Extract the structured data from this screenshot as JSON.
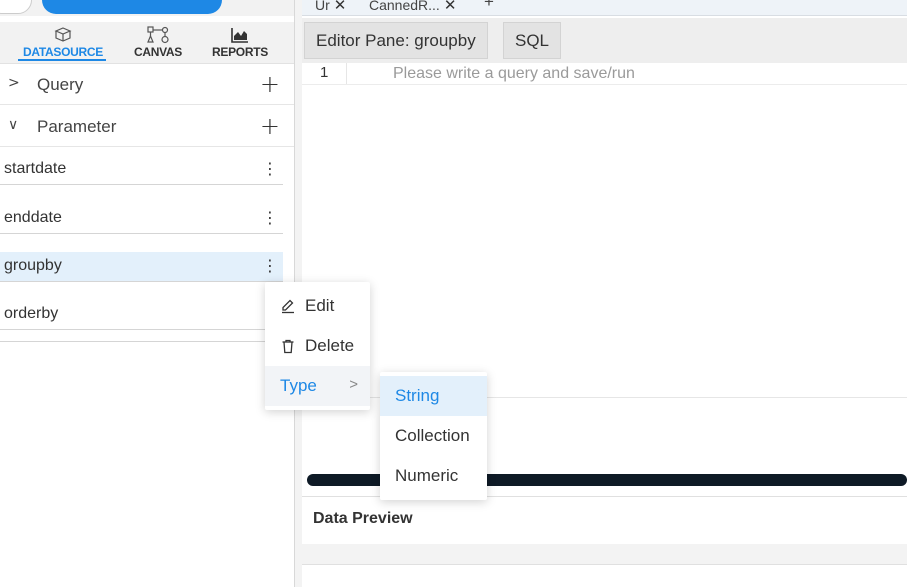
{
  "tabs": [
    {
      "label": "Ur"
    },
    {
      "label": "CannedR..."
    }
  ],
  "tab_add_label": "+",
  "nav": {
    "items": [
      {
        "label": "DATASOURCE",
        "icon": "database-icon"
      },
      {
        "label": "CANVAS",
        "icon": "canvas-icon"
      },
      {
        "label": "REPORTS",
        "icon": "reports-icon"
      }
    ],
    "active": "DATASOURCE"
  },
  "sections": {
    "query": {
      "title": "Query",
      "chevron": ">",
      "add": "+"
    },
    "parameter": {
      "title": "Parameter",
      "chevron": "∨",
      "add": "+"
    }
  },
  "parameters": [
    {
      "name": "startdate",
      "menu": "⋮"
    },
    {
      "name": "enddate",
      "menu": "⋮"
    },
    {
      "name": "groupby",
      "menu": "⋮"
    },
    {
      "name": "orderby",
      "menu": ""
    }
  ],
  "selected_parameter": "groupby",
  "toolbar": {
    "editor_pane_label": "Editor Pane: groupby",
    "sql_label": "SQL"
  },
  "editor": {
    "line_number": "1",
    "placeholder": "Please write a query and save/run"
  },
  "context_menu": {
    "items": [
      {
        "label": "Edit",
        "icon": "pencil-icon"
      },
      {
        "label": "Delete",
        "icon": "trash-icon"
      },
      {
        "label": "Type",
        "icon": "",
        "submenu_arrow": ">"
      }
    ]
  },
  "type_submenu": {
    "items": [
      {
        "label": "String",
        "selected": true
      },
      {
        "label": "Collection",
        "selected": false
      },
      {
        "label": "Numeric",
        "selected": false
      }
    ]
  },
  "data_preview": {
    "title": "Data Preview"
  },
  "colors": {
    "accent": "#1e88e5",
    "selected_row": "#e3f0fb",
    "scrollbar": "#0e1a26"
  }
}
